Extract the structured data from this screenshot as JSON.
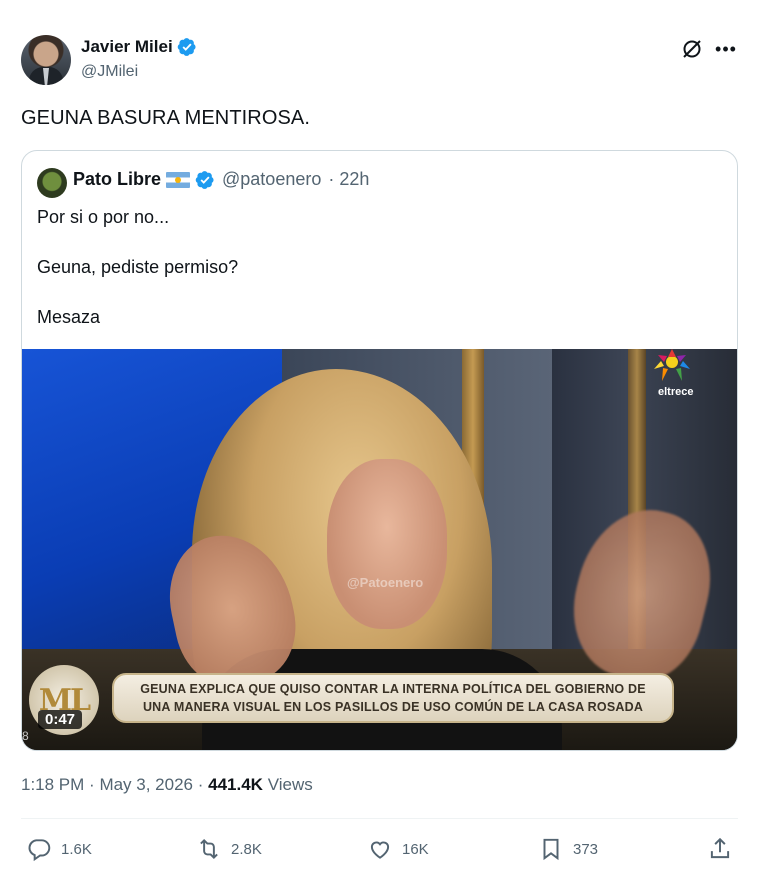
{
  "author": {
    "name": "Javier Milei",
    "handle": "@JMilei"
  },
  "tweet": {
    "text": "GEUNA BASURA MENTIROSA."
  },
  "quote": {
    "name": "Pato Libre",
    "handle": "@patoenero",
    "time": "· 22h",
    "lines": [
      "Por si o por no...",
      "Geuna, pediste permiso?",
      "Mesaza"
    ],
    "video": {
      "duration": "0:47",
      "channel": "eltrece",
      "watermark": "@Patoenero",
      "logo": "ML",
      "banner_line1": "GEUNA EXPLICA QUE QUISO CONTAR LA INTERNA POLÍTICA DEL GOBIERNO DE",
      "banner_line2": "UNA MANERA VISUAL EN LOS PASILLOS DE USO COMÚN DE LA CASA ROSADA",
      "corner_text": "8"
    }
  },
  "meta": {
    "time": "1:18 PM",
    "date": "May 3, 2026",
    "views": "441.4K",
    "views_label": "Views"
  },
  "actions": {
    "replies": "1.6K",
    "reposts": "2.8K",
    "likes": "16K",
    "bookmarks": "373"
  },
  "colors": {
    "verified": "#1d9bf0",
    "text": "#0f1419",
    "secondary": "#536471",
    "border": "#cfd9de"
  }
}
